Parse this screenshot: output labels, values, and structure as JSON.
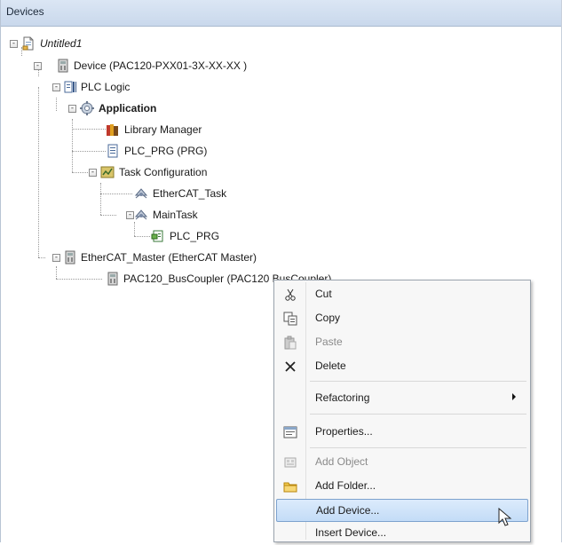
{
  "panel": {
    "title": "Devices"
  },
  "tree": {
    "root": "Untitled1",
    "device": "Device (PAC120-PXX01-3X-XX-XX )",
    "plc_logic": "PLC Logic",
    "application": "Application",
    "library_manager": "Library Manager",
    "plc_prg_prg": "PLC_PRG (PRG)",
    "task_configuration": "Task Configuration",
    "ethercat_task": "EtherCAT_Task",
    "main_task": "MainTask",
    "plc_prg": "PLC_PRG",
    "ethercat_master": "EtherCAT_Master (EtherCAT Master)",
    "bus_coupler": "PAC120_BusCoupler (PAC120 BusCoupler)"
  },
  "context_menu": {
    "cut": "Cut",
    "copy": "Copy",
    "paste": "Paste",
    "delete": "Delete",
    "refactoring": "Refactoring",
    "properties": "Properties...",
    "add_object": "Add Object",
    "add_folder": "Add Folder...",
    "add_device": "Add Device...",
    "insert_device": "Insert Device..."
  },
  "icons": {
    "expander_minus": "-",
    "project": "project-file-icon",
    "device": "device-icon",
    "plc_logic": "plc-logic-icon",
    "application": "application-gear-icon",
    "library": "library-books-icon",
    "pou": "pou-document-icon",
    "task_config": "task-configuration-icon",
    "task": "task-icon",
    "program_call": "program-call-icon",
    "folder": "folder-icon"
  },
  "colors": {
    "titlebar": "#c9d8ec",
    "selection": "#c3dcf7",
    "menu_bg": "#f7f7f7"
  }
}
